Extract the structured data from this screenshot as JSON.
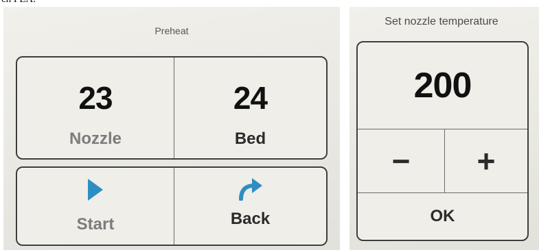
{
  "cropped_text": "ch PLA.",
  "preheat_screen": {
    "title": "Preheat",
    "nozzle": {
      "value": "23",
      "label": "Nozzle"
    },
    "bed": {
      "value": "24",
      "label": "Bed"
    },
    "start": {
      "label": "Start",
      "icon": "play-icon",
      "icon_color": "#2e8ec2"
    },
    "back": {
      "label": "Back",
      "icon": "back-arrow-icon",
      "icon_color": "#2e8ec2"
    }
  },
  "nozzle_temp_screen": {
    "title": "Set nozzle temperature",
    "value": "200",
    "minus_label": "−",
    "plus_label": "+",
    "ok_label": "OK"
  }
}
